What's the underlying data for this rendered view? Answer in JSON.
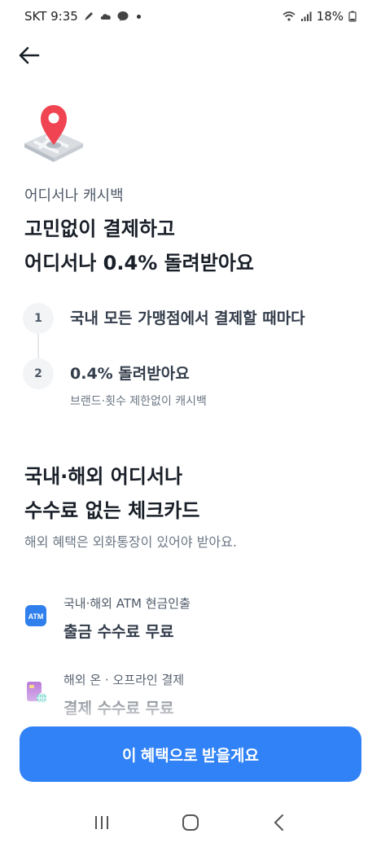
{
  "status_bar": {
    "carrier_time": "SKT 9:35",
    "battery": "18%",
    "icons": [
      "pen-icon",
      "cloud-icon",
      "talk-icon",
      "dot-icon",
      "wifi-icon",
      "signal-icon",
      "battery-icon"
    ]
  },
  "header": {
    "back_icon": "arrow-left-icon"
  },
  "hero": {
    "eyebrow": "어디서나 캐시백",
    "headline_line1": "고민없이 결제하고",
    "headline_line2": "어디서나 0.4% 돌려받아요"
  },
  "steps": [
    {
      "number": "1",
      "title": "국내 모든 가맹점에서 결제할 때마다",
      "subtitle": ""
    },
    {
      "number": "2",
      "title": "0.4% 돌려받아요",
      "subtitle": "브랜드·횟수 제한없이 캐시백"
    }
  ],
  "section": {
    "title_line1": "국내·해외 어디서나",
    "title_line2": "수수료 없는 체크카드",
    "subtitle": "해외 혜택은 외화통장이 있어야 받아요."
  },
  "benefits": [
    {
      "icon": "atm-icon",
      "icon_label": "ATM",
      "caption": "국내·해외 ATM 현금인출",
      "title": "출금 수수료 무료"
    },
    {
      "icon": "card-globe-icon",
      "caption": "해외 온 · 오프라인 결제",
      "title": "결제 수수료 무료"
    }
  ],
  "cta": {
    "label": "이 혜택으로 받을게요"
  },
  "nav": {
    "recent": "recent-apps-icon",
    "home": "home-icon",
    "back": "back-icon"
  },
  "colors": {
    "accent": "#3182f6",
    "atm_blue": "#2f80ed",
    "pin_red": "#f04452",
    "card_purple": "#b36bd6"
  }
}
